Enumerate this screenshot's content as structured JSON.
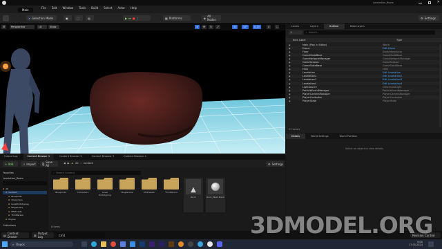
{
  "window": {
    "level_name": "Levelation_Room",
    "tab": "Main"
  },
  "menu": [
    "File",
    "Edit",
    "Window",
    "Tools",
    "Build",
    "Select",
    "Actor",
    "Help"
  ],
  "toolbar": {
    "mode": "Selection Mode",
    "platforms": "Platforms",
    "all_nodes": "All Nodes",
    "settings": "Settings"
  },
  "viewport": {
    "perspective": "Perspective",
    "lit": "Lit",
    "show": "Show",
    "grid_snap": "10",
    "rot_snap": "10°",
    "scale_snap": "0.25",
    "cam_speed": "4"
  },
  "outliner": {
    "tabs": [
      "Levels",
      "Layers",
      "Outliner",
      "Data Layers"
    ],
    "search_placeholder": "Search...",
    "col_label": "Item Label",
    "col_type": "Type",
    "rows": [
      {
        "name": "Main (Play in Editor)",
        "type": "World",
        "link": false
      },
      {
        "name": "Drone",
        "type": "Edit Drone",
        "link": true
      },
      {
        "name": "Floor",
        "type": "StaticMeshActor",
        "link": false
      },
      {
        "name": "GameModeBase",
        "type": "GameModeBase",
        "link": false
      },
      {
        "name": "GameNetworkManager",
        "type": "GameNetworkManager",
        "link": false
      },
      {
        "name": "GameSession",
        "type": "GameSession",
        "link": false
      },
      {
        "name": "GameStateBase",
        "type": "GameStateBase",
        "link": false
      },
      {
        "name": "HUD",
        "type": "HUD",
        "link": false
      },
      {
        "name": "Levelation",
        "type": "Edit Levelation",
        "link": true
      },
      {
        "name": "Levelation2",
        "type": "Edit Levelation2",
        "link": true
      },
      {
        "name": "Levelation3",
        "type": "Edit Levelation3",
        "link": true
      },
      {
        "name": "Levelation4",
        "type": "Edit Levelation4",
        "link": true
      },
      {
        "name": "LightSource",
        "type": "DirectionalLight",
        "link": false
      },
      {
        "name": "ParticleEventManager",
        "type": "ParticleEventManager",
        "link": false
      },
      {
        "name": "PlayerCameraManager",
        "type": "PlayerCameraManager",
        "link": false
      },
      {
        "name": "PlayerController",
        "type": "PlayerController",
        "link": false
      },
      {
        "name": "PlayerState",
        "type": "PlayerState",
        "link": false
      }
    ],
    "count": "17 actors"
  },
  "details": {
    "tabs": [
      "Details",
      "World Settings",
      "World Partition"
    ],
    "empty_text": "Select an object to view details."
  },
  "content_browser": {
    "tabs": [
      "Output Log",
      "Content Browser 1",
      "Content Browser 2",
      "Content Browser 3",
      "Content Browser 4"
    ],
    "add": "+ Add",
    "import": "Import",
    "save_all": "Save All",
    "path_root": "All",
    "path_current": "Content",
    "settings": "Settings",
    "favorites": "Favorites",
    "project": "Levelation_Room",
    "tree": [
      "All",
      "Content",
      "Blueprints",
      "Characters",
      "LevelPrototyping",
      "Megascans",
      "MSPresets",
      "ThirdPerson",
      "Engine"
    ],
    "collections": "Collections",
    "search_placeholder": "Search Content",
    "assets": [
      {
        "label": "Blueprints",
        "kind": "folder"
      },
      {
        "label": "Characters",
        "kind": "folder"
      },
      {
        "label": "Level Prototyping",
        "kind": "folder"
      },
      {
        "label": "Megascans",
        "kind": "folder"
      },
      {
        "label": "MSPresets",
        "kind": "folder"
      },
      {
        "label": "ThirdPerson",
        "kind": "folder"
      },
      {
        "label": "Rock",
        "kind": "texture"
      },
      {
        "label": "Rock_Mesh Mesh",
        "kind": "mesh"
      }
    ],
    "item_count": "8 items"
  },
  "statusbar": {
    "content_drawer": "Content Drawer",
    "output_log": "Output Log",
    "cmd": "Cmd",
    "source_control": "Revision Control"
  },
  "taskbar": {
    "search": "Поиск",
    "time": "9:00",
    "date": "17.05.2024"
  },
  "watermark": "3DMODEL.ORG",
  "colors": {
    "selected_tab": "#0d0d0d",
    "link_blue": "#4ea4ff",
    "folder": "#c8a45a",
    "floor": "#a8e0ee"
  }
}
